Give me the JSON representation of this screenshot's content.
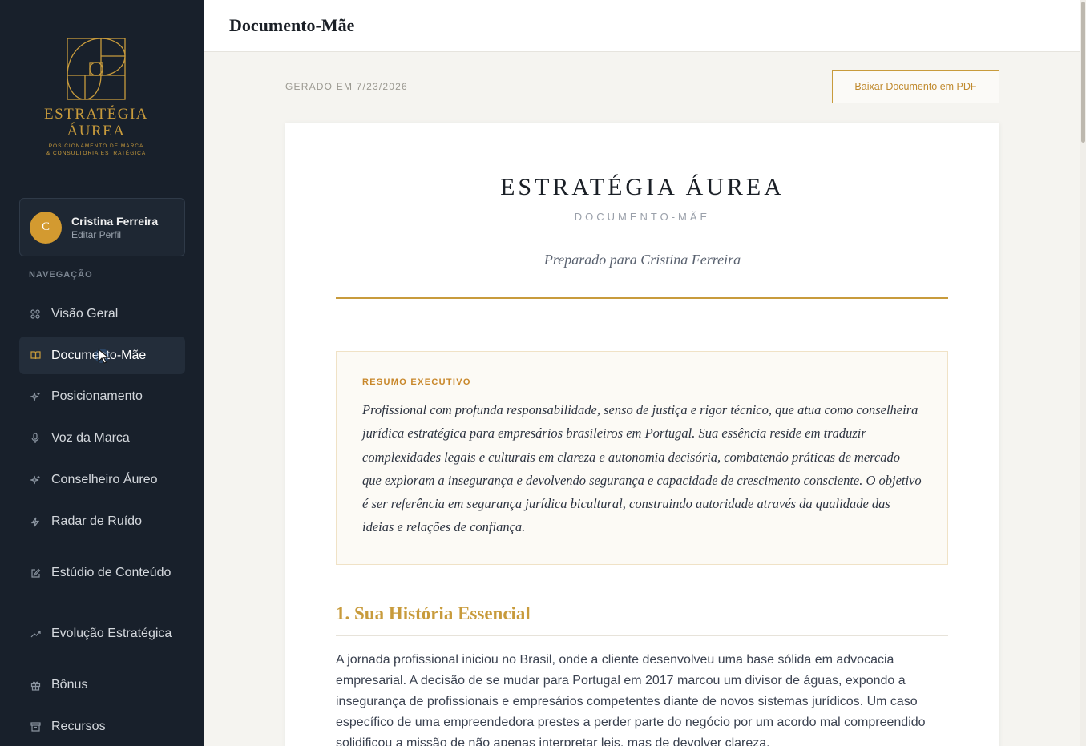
{
  "brand": {
    "name_line1": "ESTRATÉGIA",
    "name_line2": "ÁUREA",
    "tagline_line1": "POSICIONAMENTO DE MARCA",
    "tagline_line2": "& CONSULTORIA ESTRATÉGICA",
    "color": "#c89b3c"
  },
  "profile": {
    "initial": "C",
    "name": "Cristina Ferreira",
    "edit_label": "Editar Perfil"
  },
  "nav": {
    "heading": "NAVEGAÇÃO",
    "items": [
      {
        "label": "Visão Geral",
        "icon": "grid-icon"
      },
      {
        "label": "Documento-Mãe",
        "icon": "book-icon",
        "active": true
      },
      {
        "label": "Posicionamento",
        "icon": "sparkle-icon"
      },
      {
        "label": "Voz da Marca",
        "icon": "microphone-icon"
      },
      {
        "label": "Conselheiro Áureo",
        "icon": "sparkle-icon"
      },
      {
        "label": "Radar de Ruído",
        "icon": "lightning-icon"
      },
      {
        "label": "Estúdio de Conteúdo",
        "icon": "edit-icon"
      },
      {
        "label": "Evolução Estratégica",
        "icon": "trend-icon"
      },
      {
        "label": "Bônus",
        "icon": "gift-icon"
      },
      {
        "label": "Recursos",
        "icon": "archive-icon"
      }
    ]
  },
  "header": {
    "title": "Documento-Mãe"
  },
  "toolbar": {
    "generated": "GERADO EM 7/23/2026",
    "pdf_button": "Baixar Documento em PDF"
  },
  "document": {
    "title": "ESTRATÉGIA ÁUREA",
    "subtitle": "DOCUMENTO-MÃE",
    "prepared_for": "Preparado para Cristina Ferreira",
    "summary": {
      "label": "RESUMO EXECUTIVO",
      "text": "Profissional com profunda responsabilidade, senso de justiça e rigor técnico, que atua como conselheira jurídica estratégica para empresários brasileiros em Portugal. Sua essência reside em traduzir complexidades legais e culturais em clareza e autonomia decisória, combatendo práticas de mercado que exploram a insegurança e devolvendo segurança e capacidade de crescimento consciente. O objetivo é ser referência em segurança jurídica bicultural, construindo autoridade através da qualidade das ideias e relações de confiança."
    },
    "section1": {
      "title": "1. Sua História Essencial",
      "body": "A jornada profissional iniciou no Brasil, onde a cliente desenvolveu uma base sólida em advocacia empresarial. A decisão de se mudar para Portugal em 2017 marcou um divisor de águas, expondo a insegurança de profissionais e empresários competentes diante de novos sistemas jurídicos. Um caso específico de uma empreendedora prestes a perder parte do negócio por um acordo mal compreendido solidificou a missão de não apenas interpretar leis, mas de devolver clareza."
    }
  }
}
